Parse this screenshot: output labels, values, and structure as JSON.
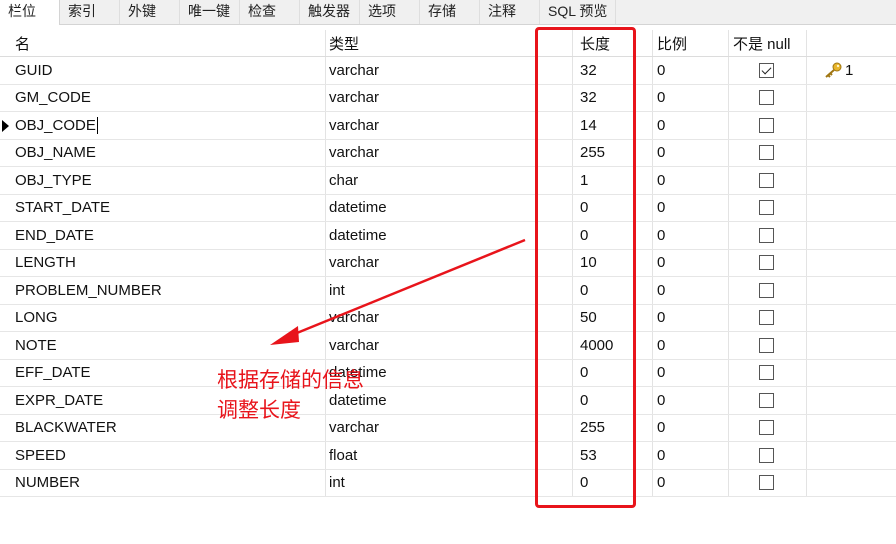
{
  "tabs": [
    "栏位",
    "索引",
    "外键",
    "唯一键",
    "检查",
    "触发器",
    "选项",
    "存储",
    "注释",
    "SQL 预览"
  ],
  "active_tab": 0,
  "columns": {
    "name": "名",
    "type": "类型",
    "length": "长度",
    "scale": "比例",
    "not_null": "不是 null"
  },
  "fields": [
    {
      "name": "GUID",
      "type": "varchar",
      "length": "32",
      "scale": "0",
      "not_null": true,
      "key": "1"
    },
    {
      "name": "GM_CODE",
      "type": "varchar",
      "length": "32",
      "scale": "0",
      "not_null": false
    },
    {
      "name": "OBJ_CODE",
      "type": "varchar",
      "length": "14",
      "scale": "0",
      "not_null": false,
      "current": true
    },
    {
      "name": "OBJ_NAME",
      "type": "varchar",
      "length": "255",
      "scale": "0",
      "not_null": false
    },
    {
      "name": "OBJ_TYPE",
      "type": "char",
      "length": "1",
      "scale": "0",
      "not_null": false
    },
    {
      "name": "START_DATE",
      "type": "datetime",
      "length": "0",
      "scale": "0",
      "not_null": false
    },
    {
      "name": "END_DATE",
      "type": "datetime",
      "length": "0",
      "scale": "0",
      "not_null": false
    },
    {
      "name": "LENGTH",
      "type": "varchar",
      "length": "10",
      "scale": "0",
      "not_null": false
    },
    {
      "name": "PROBLEM_NUMBER",
      "type": "int",
      "length": "0",
      "scale": "0",
      "not_null": false
    },
    {
      "name": "LONG",
      "type": "varchar",
      "length": "50",
      "scale": "0",
      "not_null": false
    },
    {
      "name": "NOTE",
      "type": "varchar",
      "length": "4000",
      "scale": "0",
      "not_null": false
    },
    {
      "name": "EFF_DATE",
      "type": "datetime",
      "length": "0",
      "scale": "0",
      "not_null": false
    },
    {
      "name": "EXPR_DATE",
      "type": "datetime",
      "length": "0",
      "scale": "0",
      "not_null": false
    },
    {
      "name": "BLACKWATER",
      "type": "varchar",
      "length": "255",
      "scale": "0",
      "not_null": false
    },
    {
      "name": "SPEED",
      "type": "float",
      "length": "53",
      "scale": "0",
      "not_null": false
    },
    {
      "name": "NUMBER",
      "type": "int",
      "length": "0",
      "scale": "0",
      "not_null": false
    }
  ],
  "annotation": {
    "line1": "根据存储的信息",
    "line2": "调整长度",
    "color": "#e8141b"
  },
  "icons": {
    "primary_key": "key-icon",
    "row_marker": "current-row-triangle-icon",
    "checkbox": "checkbox-icon"
  }
}
